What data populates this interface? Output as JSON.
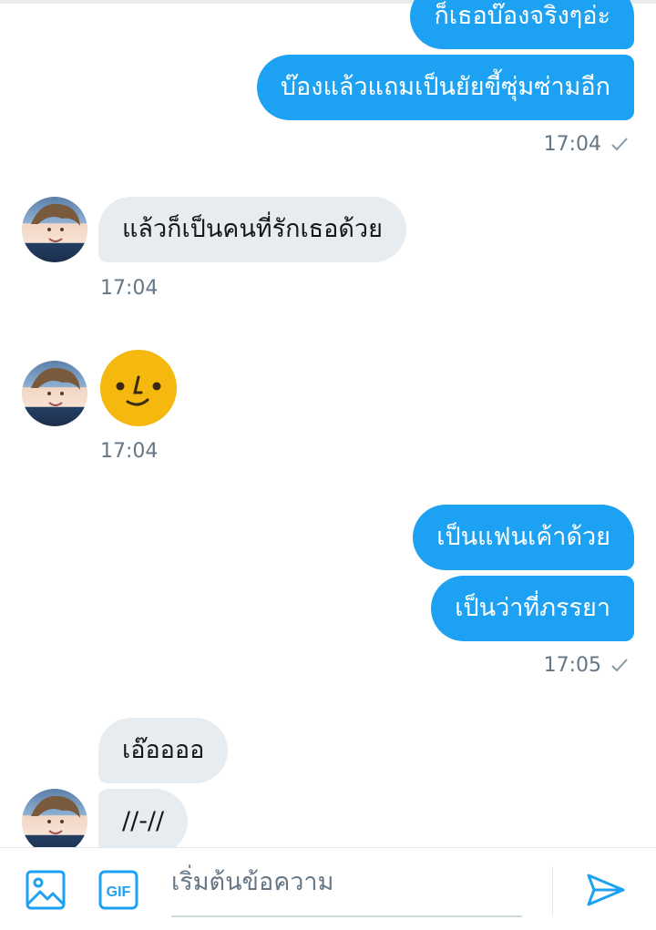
{
  "conversation": {
    "messages": [
      {
        "side": "out",
        "text": "ก็เธอบ๊องจริงๆอ่ะ"
      },
      {
        "side": "out",
        "text": "บ๊องแล้วแถมเป็นยัยขี้ซุ่มซ่ามอีก"
      },
      {
        "side": "in",
        "text": "แล้วก็เป็นคนที่รักเธอด้วย"
      },
      {
        "side": "out",
        "text": "เป็นแฟนเค้าด้วย"
      },
      {
        "side": "out",
        "text": "เป็นว่าที่ภรรยา"
      },
      {
        "side": "in",
        "text": "เอ๊ออออ"
      },
      {
        "side": "in",
        "text": "//-//"
      }
    ],
    "timestamps": [
      "17:04",
      "17:04",
      "17:04",
      "17:05"
    ],
    "emoji_icon": "slightly-smiling-face-emoji",
    "avatar_icon": "user-avatar"
  },
  "composer": {
    "placeholder": "เริ่มต้นข้อความ",
    "icons": {
      "media": "image-icon",
      "gif": "gif-icon",
      "send": "send-icon"
    },
    "gif_label": "GIF"
  },
  "colors": {
    "accent": "#1da1f2",
    "incoming_bubble": "#e6ecf0",
    "timestamp": "#657786",
    "emoji": "#f5b80f"
  }
}
